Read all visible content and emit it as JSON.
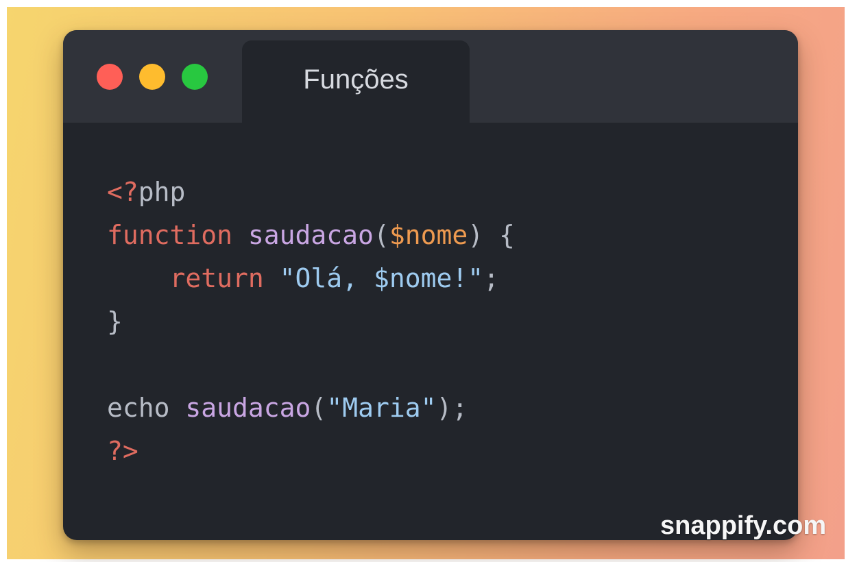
{
  "window": {
    "tab_title": "Funções",
    "controls": [
      {
        "name": "close",
        "color": "#ff5f57"
      },
      {
        "name": "minimize",
        "color": "#febc2e"
      },
      {
        "name": "maximize",
        "color": "#28c840"
      }
    ]
  },
  "code": {
    "language": "php",
    "lines": [
      [
        {
          "text": "<?",
          "color": "#e06c60"
        },
        {
          "text": "php",
          "color": "#b7bcc6"
        }
      ],
      [
        {
          "text": "function ",
          "color": "#e06c60"
        },
        {
          "text": "saudacao",
          "color": "#c9a6e3"
        },
        {
          "text": "(",
          "color": "#b7bcc6"
        },
        {
          "text": "$nome",
          "color": "#ee9a50"
        },
        {
          "text": ") {",
          "color": "#b7bcc6"
        }
      ],
      [
        {
          "text": "    ",
          "color": "#b7bcc6"
        },
        {
          "text": "return ",
          "color": "#e06c60"
        },
        {
          "text": "\"Olá, $nome!\"",
          "color": "#9ecbf0"
        },
        {
          "text": ";",
          "color": "#b7bcc6"
        }
      ],
      [
        {
          "text": "}",
          "color": "#b7bcc6"
        }
      ],
      [],
      [
        {
          "text": "echo ",
          "color": "#b7bcc6"
        },
        {
          "text": "saudacao",
          "color": "#c9a6e3"
        },
        {
          "text": "(",
          "color": "#b7bcc6"
        },
        {
          "text": "\"Maria\"",
          "color": "#9ecbf0"
        },
        {
          "text": ");",
          "color": "#b7bcc6"
        }
      ],
      [
        {
          "text": "?>",
          "color": "#e06c60"
        }
      ]
    ]
  },
  "watermark": "snappify.com"
}
